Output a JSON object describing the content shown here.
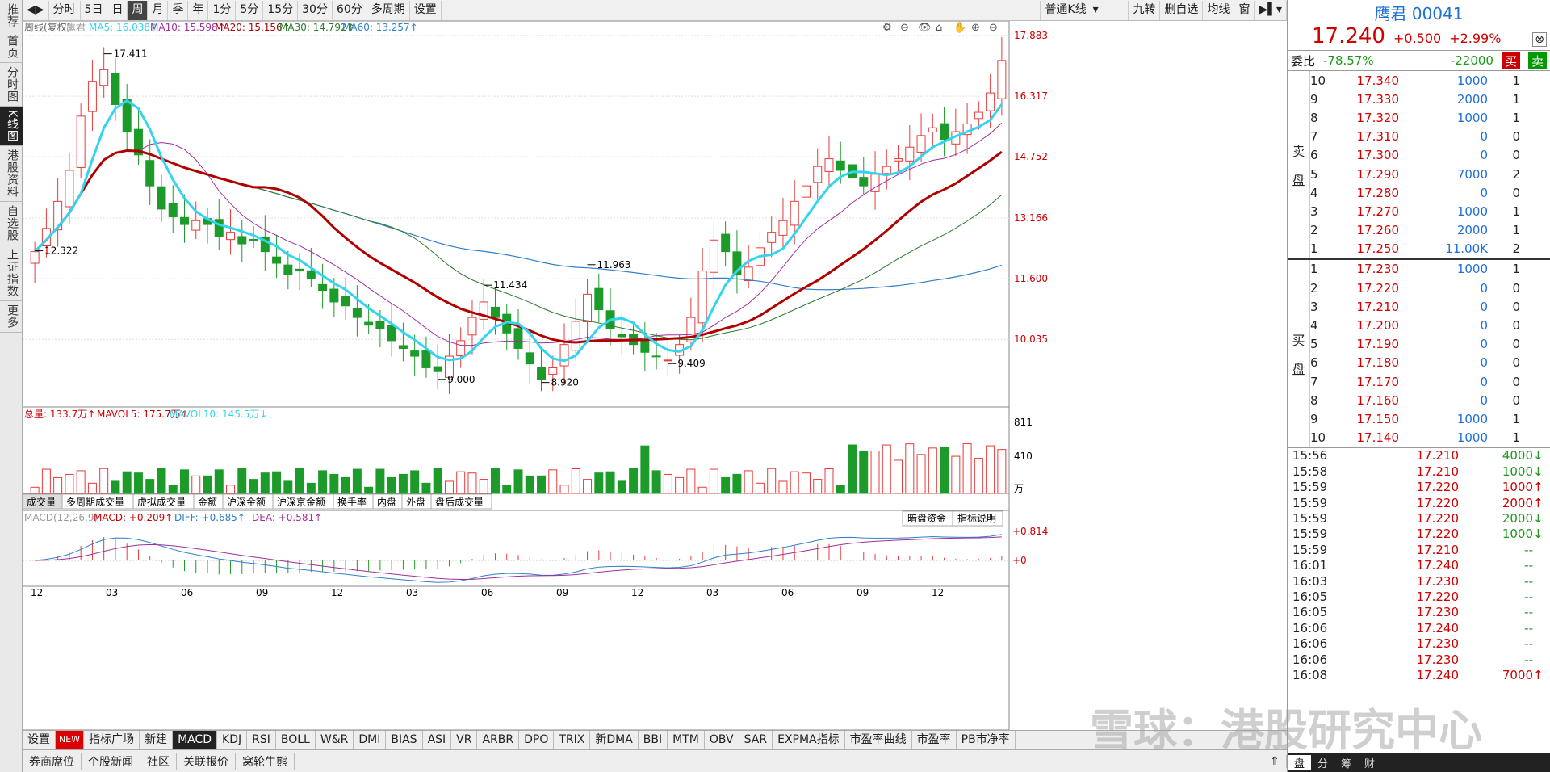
{
  "left_rail": [
    "推荐",
    "首页",
    "分时图",
    "K线图",
    "港股资料",
    "自选股",
    "上证指数",
    "更多"
  ],
  "left_rail_active": 3,
  "toolbar": {
    "items": [
      "分时",
      "5日",
      "日",
      "周",
      "月",
      "季",
      "年",
      "1分",
      "5分",
      "15分",
      "30分",
      "60分",
      "多周期",
      "设置"
    ],
    "selected": "周",
    "kline_type": "普通K线",
    "right_items": [
      "九转",
      "删自选",
      "均线",
      "窗"
    ]
  },
  "legend": {
    "main": "周线(复权)",
    "stock": "鹰君",
    "ma5": "MA5: 16.038↑",
    "ma10": "MA10: 15.598↑",
    "ma20": "MA20: 15.156↑",
    "ma30": "MA30: 14.792↑",
    "ma60": "MA60: 13.257↑",
    "vol": "总量: 133.7万↑",
    "mavol5": "MAVOL5: 175.7万↑",
    "mavol10": "MAVOL10: 145.5万↓",
    "macd_name": "MACD(12,26,9)",
    "macd": "MACD: +0.209↑",
    "diff": "DIFF: +0.685↑",
    "dea": "DEA: +0.581↑"
  },
  "indicator_tabs": [
    "成交量",
    "多周期成交量",
    "虚拟成交量",
    "金额",
    "沪深金额",
    "沪深京金额",
    "换手率",
    "内盘",
    "外盘",
    "盘后成交量"
  ],
  "indicator_tab_selected": "成交量",
  "macd_buttons": [
    "暗盘资金",
    "指标说明"
  ],
  "price_axis": [
    "17.883",
    "16.317",
    "14.752",
    "13.166",
    "11.600",
    "10.035"
  ],
  "vol_axis": [
    "811",
    "410",
    "万"
  ],
  "macd_axis": [
    "+0.814",
    "+0"
  ],
  "date_axis": [
    "12",
    "03",
    "06",
    "09",
    "12",
    "03",
    "06",
    "09",
    "12",
    "03",
    "06",
    "09",
    "12"
  ],
  "annotations": [
    "17.411",
    "12.322",
    "11.434",
    "11.963",
    "9.000",
    "8.920",
    "9.409"
  ],
  "colors": {
    "up": "#e83a3a",
    "down": "#1d9b2a",
    "ma5": "#33d4f0",
    "ma10": "#a0309a",
    "ma20": "#b00000",
    "ma30": "#2a7a2a",
    "ma60": "#2f7fc9"
  },
  "chart_data": {
    "type": "candlestick",
    "weekly_close_approx": [
      12.3,
      12.9,
      13.6,
      14.4,
      15.8,
      16.7,
      17.0,
      16.1,
      15.4,
      14.8,
      14.0,
      13.4,
      13.2,
      13.0,
      13.1,
      13.0,
      12.7,
      12.8,
      12.5,
      12.6,
      12.3,
      12.0,
      11.7,
      11.8,
      11.6,
      11.3,
      11.0,
      10.9,
      10.6,
      10.4,
      10.3,
      10.0,
      9.8,
      9.6,
      9.3,
      9.2,
      9.6,
      10.0,
      10.6,
      11.0,
      10.6,
      10.2,
      9.8,
      9.4,
      9.0,
      9.3,
      9.9,
      10.5,
      11.2,
      10.8,
      10.3,
      10.1,
      9.9,
      9.7,
      9.6,
      9.5,
      9.9,
      10.6,
      11.8,
      12.6,
      12.3,
      11.7,
      11.9,
      12.4,
      12.8,
      13.1,
      13.6,
      14.0,
      14.5,
      14.7,
      14.4,
      14.2,
      14.0,
      14.3,
      14.5,
      14.7,
      15.0,
      15.3,
      15.5,
      15.2,
      15.4,
      15.6,
      15.9,
      16.4,
      17.24
    ],
    "current_ma": {
      "MA5": 16.038,
      "MA10": 15.598,
      "MA20": 15.156,
      "MA30": 14.792,
      "MA60": 13.257
    },
    "price_range": [
      8.92,
      17.883
    ]
  },
  "quote": {
    "name_code": "鹰君 00041",
    "price": "17.240",
    "change": "+0.500",
    "pct": "+2.99%",
    "weibi_label": "委比",
    "weibi": "-78.57%",
    "weicha": "-22000",
    "sell_btn": "买",
    "buy_btn": "卖",
    "sell_label": [
      "卖",
      "盘"
    ],
    "buy_label": [
      "买",
      "盘"
    ],
    "asks": [
      [
        "10",
        "17.340",
        "1000",
        "1"
      ],
      [
        "9",
        "17.330",
        "2000",
        "1"
      ],
      [
        "8",
        "17.320",
        "1000",
        "1"
      ],
      [
        "7",
        "17.310",
        "0",
        "0"
      ],
      [
        "6",
        "17.300",
        "0",
        "0"
      ],
      [
        "5",
        "17.290",
        "7000",
        "2"
      ],
      [
        "4",
        "17.280",
        "0",
        "0"
      ],
      [
        "3",
        "17.270",
        "1000",
        "1"
      ],
      [
        "2",
        "17.260",
        "2000",
        "1"
      ],
      [
        "1",
        "17.250",
        "11.00K",
        "2"
      ]
    ],
    "bids": [
      [
        "1",
        "17.230",
        "1000",
        "1"
      ],
      [
        "2",
        "17.220",
        "0",
        "0"
      ],
      [
        "3",
        "17.210",
        "0",
        "0"
      ],
      [
        "4",
        "17.200",
        "0",
        "0"
      ],
      [
        "5",
        "17.190",
        "0",
        "0"
      ],
      [
        "6",
        "17.180",
        "0",
        "0"
      ],
      [
        "7",
        "17.170",
        "0",
        "0"
      ],
      [
        "8",
        "17.160",
        "0",
        "0"
      ],
      [
        "9",
        "17.150",
        "1000",
        "1"
      ],
      [
        "10",
        "17.140",
        "1000",
        "1"
      ]
    ],
    "trades": [
      [
        "15:56",
        "17.210",
        "4000",
        "↓"
      ],
      [
        "15:58",
        "17.210",
        "1000",
        "↓"
      ],
      [
        "15:59",
        "17.220",
        "1000",
        "↑"
      ],
      [
        "15:59",
        "17.220",
        "2000",
        "↑"
      ],
      [
        "15:59",
        "17.220",
        "2000",
        "↓"
      ],
      [
        "15:59",
        "17.220",
        "1000",
        "↓"
      ],
      [
        "15:59",
        "17.210",
        "--",
        ""
      ],
      [
        "16:01",
        "17.240",
        "--",
        ""
      ],
      [
        "16:03",
        "17.230",
        "--",
        ""
      ],
      [
        "16:05",
        "17.220",
        "--",
        ""
      ],
      [
        "16:05",
        "17.230",
        "--",
        ""
      ],
      [
        "16:06",
        "17.240",
        "--",
        ""
      ],
      [
        "16:06",
        "17.230",
        "--",
        ""
      ],
      [
        "16:06",
        "17.230",
        "--",
        ""
      ],
      [
        "16:08",
        "17.240",
        "7000",
        "↑"
      ]
    ],
    "bottom_tabs": [
      "盘",
      "分",
      "筹",
      "财"
    ]
  },
  "bottom_indicators": [
    "设置",
    "NEW",
    "指标广场",
    "新建",
    "MACD",
    "KDJ",
    "RSI",
    "BOLL",
    "W&R",
    "DMI",
    "BIAS",
    "ASI",
    "VR",
    "ARBR",
    "DPO",
    "TRIX",
    "新DMA",
    "BBI",
    "MTM",
    "OBV",
    "SAR",
    "EXPMA指标",
    "市盈率曲线",
    "市盈率",
    "PB市净率"
  ],
  "bottom_selected": "MACD",
  "status": [
    "券商席位",
    "个股新闻",
    "社区",
    "关联报价",
    "窝轮牛熊"
  ],
  "watermark": "雪球：港股研究中心"
}
